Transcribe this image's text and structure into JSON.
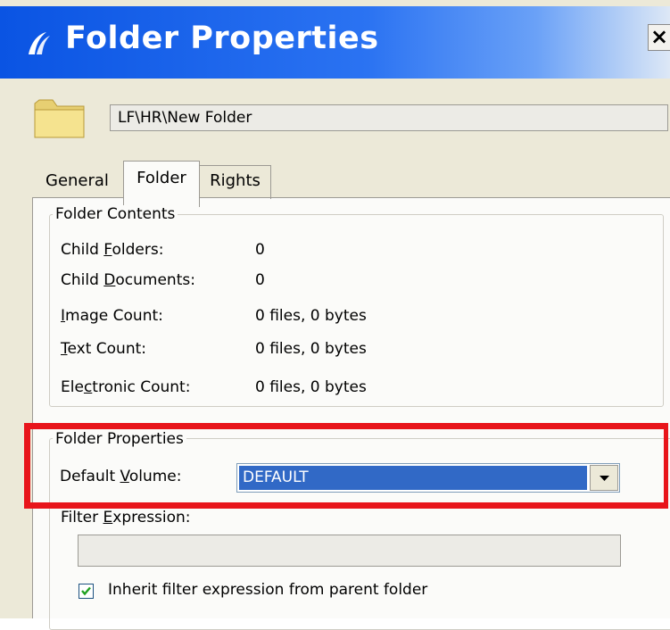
{
  "window": {
    "title": "Folder Properties",
    "close_glyph": "×"
  },
  "path": "LF\\HR\\New Folder",
  "tabs": [
    {
      "label": "General"
    },
    {
      "label": "Folder"
    },
    {
      "label": "Rights"
    }
  ],
  "folder_contents": {
    "title": "Folder Contents",
    "rows": [
      {
        "pre": "Child ",
        "acc": "F",
        "post": "olders:",
        "value": "0"
      },
      {
        "pre": "Child ",
        "acc": "D",
        "post": "ocuments:",
        "value": "0"
      },
      {
        "pre": "",
        "acc": "I",
        "post": "mage Count:",
        "value": "0 files, 0 bytes"
      },
      {
        "pre": "",
        "acc": "T",
        "post": "ext Count:",
        "value": "0 files, 0 bytes"
      },
      {
        "pre": "Ele",
        "acc": "c",
        "post": "tronic Count:",
        "value": "0 files, 0 bytes"
      }
    ]
  },
  "folder_properties": {
    "title": "Folder Properties",
    "default_volume": {
      "pre": "Default ",
      "acc": "V",
      "post": "olume:",
      "value": "DEFAULT"
    },
    "filter_expression": {
      "pre": "Filter ",
      "acc": "E",
      "post": "xpression:",
      "value": ""
    },
    "inherit_checkbox": {
      "label": "Inherit filter expression from parent folder",
      "checked": true
    }
  },
  "colors": {
    "title_bar": "#0a54e3",
    "highlight": "#e8151b",
    "selection": "#3169c6"
  },
  "icons": {
    "app_logo": "laserfiche-logo-icon",
    "folder": "folder-icon",
    "close": "close-icon",
    "dropdown": "chevron-down-icon",
    "check": "checkmark-icon"
  }
}
